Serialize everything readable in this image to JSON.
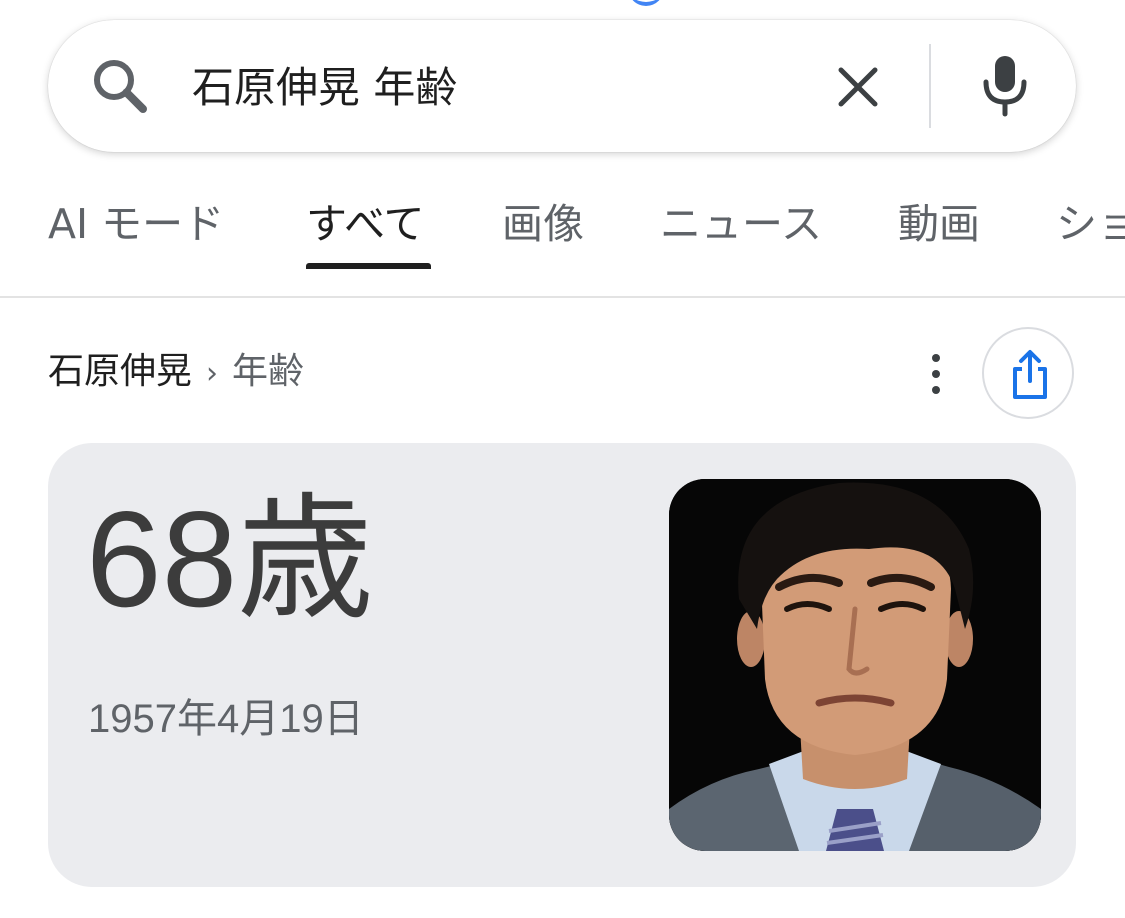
{
  "search": {
    "query": "石原伸晃 年齢",
    "icons": [
      "search-icon",
      "clear-icon",
      "mic-icon"
    ]
  },
  "tabs": [
    {
      "label": "AI モード",
      "active": false
    },
    {
      "label": "すべて",
      "active": true
    },
    {
      "label": "画像",
      "active": false
    },
    {
      "label": "ニュース",
      "active": false
    },
    {
      "label": "動画",
      "active": false
    },
    {
      "label": "ショ",
      "active": false
    }
  ],
  "result": {
    "breadcrumb": {
      "entity": "石原伸晃",
      "separator": "›",
      "attribute": "年齢"
    },
    "icons": [
      "more-vert-icon",
      "share-icon"
    ],
    "answer": {
      "age": "68歳",
      "birth_date": "1957年4月19日",
      "image": "portrait photo of man in suit"
    }
  },
  "colors": {
    "background": "#ffffff",
    "card_background": "#ebecef",
    "primary_text": "#1f1f1f",
    "secondary_text": "#5f6368",
    "share_icon": "#1a73e8",
    "active_tab_indicator": "#1f1f1f"
  }
}
